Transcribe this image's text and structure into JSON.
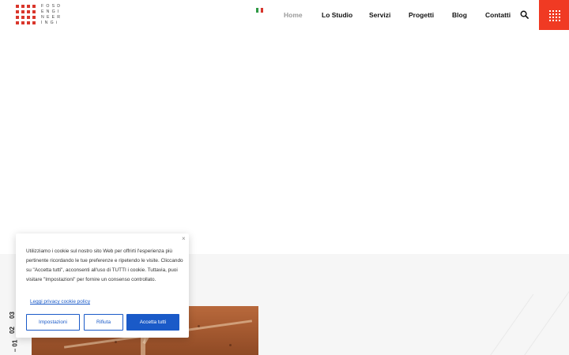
{
  "brand": {
    "logo_lines": [
      "FOSD",
      "ENGI",
      "NEER",
      "INGi"
    ],
    "accent_color": "#f03a23"
  },
  "language": {
    "icon": "italy-flag-icon"
  },
  "nav": {
    "items": [
      {
        "label": "Home",
        "active": true
      },
      {
        "label": "Lo Studio",
        "active": false
      },
      {
        "label": "Servizi",
        "active": false
      },
      {
        "label": "Progetti",
        "active": false
      },
      {
        "label": "Blog",
        "active": false
      },
      {
        "label": "Contatti",
        "active": false
      }
    ],
    "search_icon": "search-icon",
    "menu_icon": "grid-menu-icon"
  },
  "slider": {
    "indices": [
      "01",
      "02",
      "03"
    ],
    "current": "01"
  },
  "cookie_banner": {
    "text": "Utilizziamo i cookie sul nostro sito Web per offrirti l'esperienza più pertinente ricordando le tue preferenze e ripetendo le visite. Cliccando su \"Accetta tutti\", acconsenti all'uso di TUTTI i cookie. Tuttavia, puoi visitare \"Impostazioni\" per fornire un consenso controllato.",
    "close_glyph": "×",
    "policy_link": "Leggi privacy cookie policy",
    "buttons": {
      "settings": "Impostazioni",
      "reject": "Rifiuta",
      "accept": "Accetta tutti"
    },
    "button_color": "#1a5ac8"
  }
}
